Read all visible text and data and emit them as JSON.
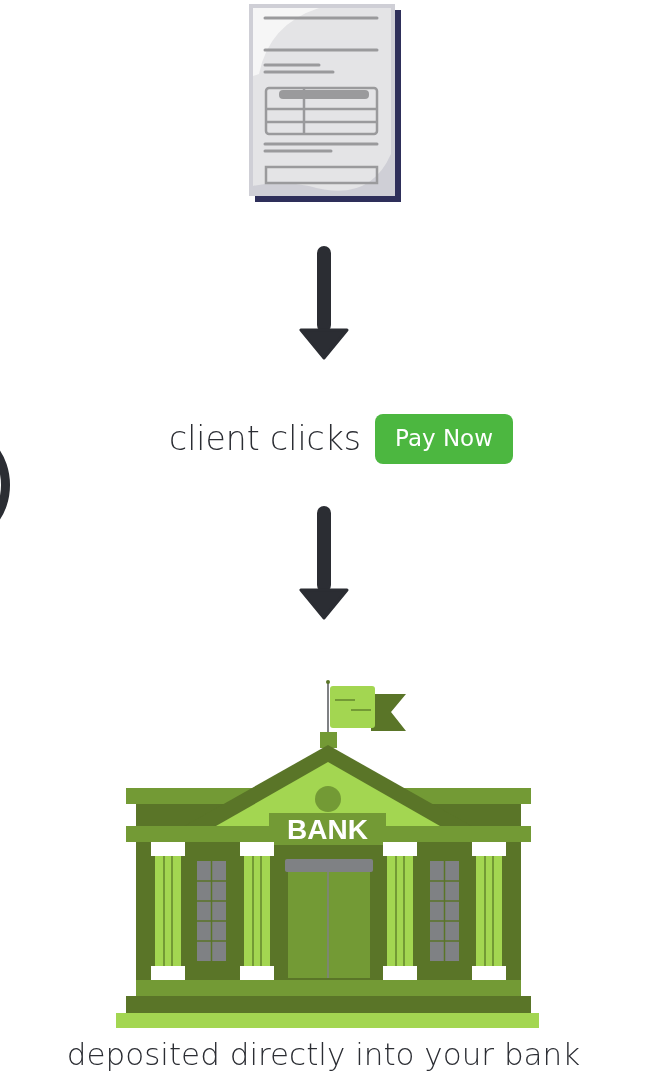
{
  "step_text": "client clicks",
  "pay_button": {
    "label": "Pay Now"
  },
  "bank_sign": "BANK",
  "caption": "deposited directly into your bank"
}
